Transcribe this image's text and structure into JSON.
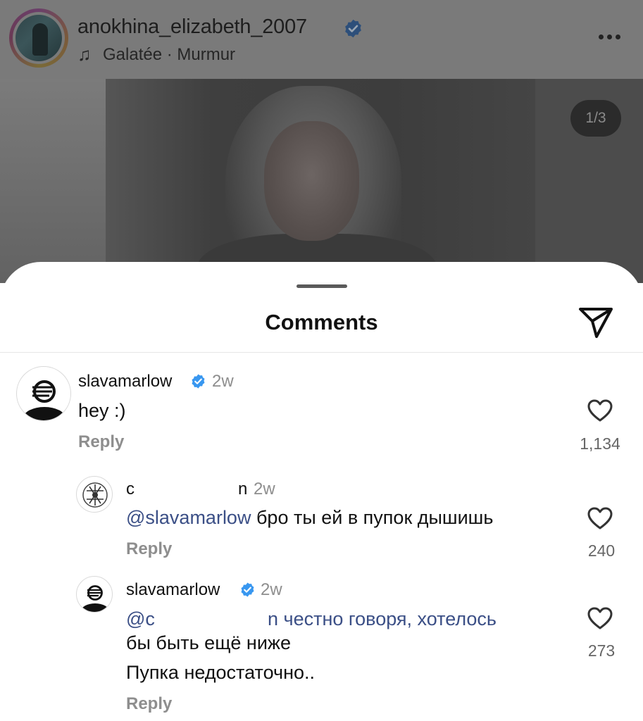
{
  "post": {
    "username": "anokhina_elizabeth_2007",
    "audio": "Galatée · Murmur",
    "page_indicator": "1/3"
  },
  "comments_sheet": {
    "title": "Comments",
    "comments": [
      {
        "username": "slavamarlow",
        "verified": true,
        "time": "2w",
        "text": "hey :)",
        "reply_label": "Reply",
        "likes": "1,134"
      },
      {
        "username_start": "c",
        "username_end": "n",
        "time": "2w",
        "mention": "@slavamarlow",
        "text": "бро ты ей в пупок дышишь",
        "reply_label": "Reply",
        "likes": "240"
      },
      {
        "username": "slavamarlow",
        "verified": true,
        "time": "2w",
        "mention": "@c",
        "line1_rest": "n честно говоря, хотелось",
        "line2": "бы быть ещё ниже",
        "line3": "Пупка недостаточно..",
        "reply_label": "Reply",
        "likes": "273"
      }
    ]
  },
  "colors": {
    "verified_blue": "#3897f0",
    "mention_color": "#3b4f86",
    "secondary_text": "#8e8e8e"
  },
  "icons": [
    "music-note-icon",
    "verified-icon",
    "more-icon",
    "share-icon",
    "heart-icon"
  ]
}
